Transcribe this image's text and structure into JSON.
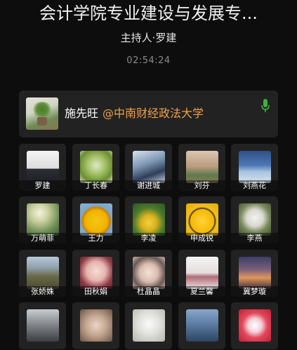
{
  "header": {
    "title": "会计学院专业建设与发展专...",
    "host": "主持人·罗建",
    "timer": "02:54:24"
  },
  "speaker": {
    "name": "施先旺",
    "org": "@中南财经政法大学",
    "mic_icon": "mic-icon",
    "mic_color": "#3cb043"
  },
  "participants": [
    {
      "name": "罗建",
      "bg": "linear-gradient(180deg,#f4f4f4 0%,#dcdcdc 55%,#2c2c34 56%,#1f1f26 100%)"
    },
    {
      "name": "丁长春",
      "bg": "radial-gradient(circle at 50% 45%,#dfe9c8 0%,#a9c46e 35%,#6a8f2f 70%,#e9ecd9 100%)"
    },
    {
      "name": "谢进城",
      "bg": "linear-gradient(160deg,#d7e3ef 0%,#7f98b6 40%,#2e3e5a 70%,#c9d3de 100%)"
    },
    {
      "name": "刘芬",
      "bg": "linear-gradient(180deg,#d9c6b2 0%,#b99a7b 50%,#5e7a4d 75%,#8a7a55 100%)"
    },
    {
      "name": "刘燕花",
      "bg": "linear-gradient(180deg,#2d4f86 0%,#4d79b5 45%,#a9c3e0 65%,#d8e2ec 100%)"
    },
    {
      "name": "万萌菲",
      "bg": "radial-gradient(circle at 40% 30%,#f6f2df 0%,#c9cf9e 30%,#6e8f55 65%,#3d5a35 100%)"
    },
    {
      "name": "王力",
      "bg": "radial-gradient(circle at 50% 55%,#f5c518 0%,#f0b400 45%,#c77d0a 60%,#7fa6c8 62%,#8bb0cc 100%)"
    },
    {
      "name": "李凌",
      "bg": "radial-gradient(circle at 50% 60%,#f3d23a 0%,#d9b21e 30%,#4b7a2e 60%,#2f5420 100%)"
    },
    {
      "name": "申成锐",
      "bg": "radial-gradient(circle at 50% 55%,#ffd23c 0%,#f5b800 50%,#3a2a12 52%,#f0c020 60%,#e8a800 100%)"
    },
    {
      "name": "李燕",
      "bg": "radial-gradient(circle at 50% 45%,#f4f4f0 0%,#d8d8cf 35%,#7a8a5c 60%,#3e4a2e 100%)"
    },
    {
      "name": "张娇姝",
      "bg": "linear-gradient(180deg,#b7c7d9 0%,#8ea0a8 35%,#6b6a4a 60%,#4a4a34 100%)"
    },
    {
      "name": "田秋娟",
      "bg": "radial-gradient(circle at 50% 45%,#f6dcd6 0%,#e6b4ae 40%,#8e3b45 70%,#5c2530 100%)"
    },
    {
      "name": "杜晶晶",
      "bg": "radial-gradient(circle at 50% 50%,#f3e2d8 0%,#d9bcae 40%,#6b5a55 70%,#cbb8b0 100%)"
    },
    {
      "name": "夏兰馨",
      "bg": "linear-gradient(180deg,#f3f3f3 0%,#e5dede 50%,#b06b75 62%,#ebe5e5 100%)"
    },
    {
      "name": "冀梦璇",
      "bg": "linear-gradient(180deg,#3b3f66 0%,#7d5f7a 40%,#e0955a 65%,#3a3040 100%)"
    },
    {
      "name": "",
      "bg": "linear-gradient(180deg,#c9ccd0 0%,#8c8f94 40%,#3a3d42 100%)"
    },
    {
      "name": "",
      "bg": "radial-gradient(circle at 50% 50%,#e9d6c8 0%,#c4a690 45%,#6a5446 100%)"
    },
    {
      "name": "",
      "bg": "radial-gradient(circle at 50% 45%,#fafafa 0%,#e0e0dc 45%,#b5b5ad 100%)"
    },
    {
      "name": "",
      "bg": "linear-gradient(180deg,#8aa6c9 0%,#5c7da6 45%,#2e4360 100%)"
    },
    {
      "name": "",
      "bg": "radial-gradient(circle at 50% 50%,#ffffff 0%,#f2d0d8 30%,#e3485a 55%,#c21e38 100%)"
    }
  ]
}
